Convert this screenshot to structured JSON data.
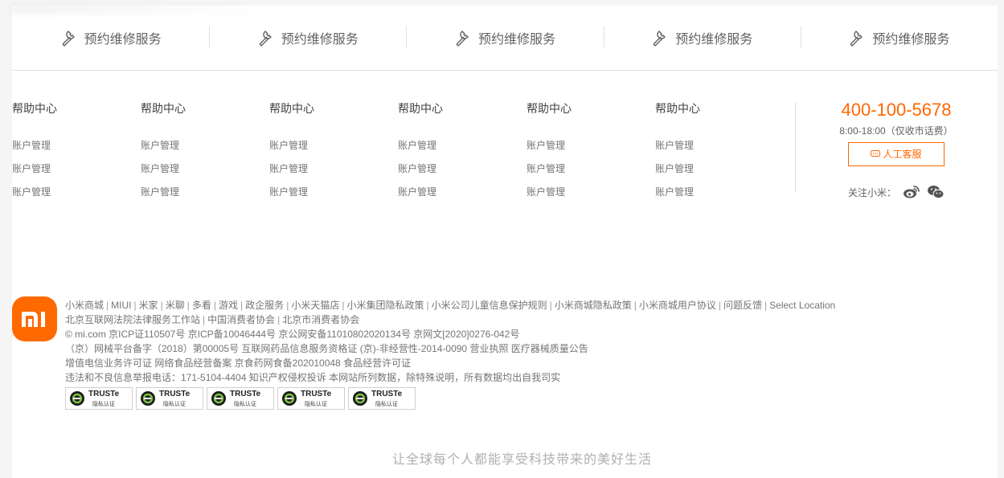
{
  "services": [
    {
      "label": "预约维修服务",
      "icon": "wrench-icon"
    },
    {
      "label": "预约维修服务",
      "icon": "wrench-icon"
    },
    {
      "label": "预约维修服务",
      "icon": "wrench-icon"
    },
    {
      "label": "预约维修服务",
      "icon": "wrench-icon"
    },
    {
      "label": "预约维修服务",
      "icon": "wrench-icon"
    }
  ],
  "link_columns": [
    {
      "title": "帮助中心",
      "items": [
        "账户管理",
        "账户管理",
        "账户管理"
      ]
    },
    {
      "title": "帮助中心",
      "items": [
        "账户管理",
        "账户管理",
        "账户管理"
      ]
    },
    {
      "title": "帮助中心",
      "items": [
        "账户管理",
        "账户管理",
        "账户管理"
      ]
    },
    {
      "title": "帮助中心",
      "items": [
        "账户管理",
        "账户管理",
        "账户管理"
      ]
    },
    {
      "title": "帮助中心",
      "items": [
        "账户管理",
        "账户管理",
        "账户管理"
      ]
    },
    {
      "title": "帮助中心",
      "items": [
        "账户管理",
        "账户管理",
        "账户管理"
      ]
    }
  ],
  "contact": {
    "phone": "400-100-5678",
    "hours": "8:00-18:00（仅收市话费）",
    "service_button": "人工客服",
    "follow_label": "关注小米：",
    "social_icons": [
      "weibo-icon",
      "wechat-icon"
    ]
  },
  "footer": {
    "nav_links": [
      "小米商城",
      "MIUI",
      "米家",
      "米聊",
      "多看",
      "游戏",
      "政企服务",
      "小米天猫店",
      "小米集团隐私政策",
      "小米公司儿童信息保护规则",
      "小米商城隐私政策",
      "小米商城用户协议",
      "问题反馈",
      "Select Location"
    ],
    "nav_links2": [
      "北京互联网法院法律服务工作站",
      "中国消费者协会",
      "北京市消费者协会"
    ],
    "lines": [
      "© mi.com 京ICP证110507号 京ICP备10046444号 京公网安备11010802020134号 京网文[2020]0276-042号",
      "（京）网械平台备字（2018）第00005号 互联网药品信息服务资格证 (京)-非经营性-2014-0090 营业执照 医疗器械质量公告",
      "增值电信业务许可证 网络食品经营备案 京食药网食备202010048   食品经营许可证",
      "违法和不良信息举报电话：171-5104-4404 知识产权侵权投诉 本网站所列数据，除特殊说明，所有数据均出自我司实"
    ],
    "badges": [
      {
        "text": "TRUSTe",
        "sub": "隐私认证"
      },
      {
        "text": "TRUSTe",
        "sub": "隐私认证"
      },
      {
        "text": "TRUSTe",
        "sub": "隐私认证"
      },
      {
        "text": "TRUSTe",
        "sub": "隐私认证"
      },
      {
        "text": "TRUSTe",
        "sub": "隐私认证"
      }
    ],
    "slogan": "让全球每个人都能享受科技带来的美好生活"
  },
  "colors": {
    "accent": "#ff6700",
    "logo": "#ff6900"
  }
}
